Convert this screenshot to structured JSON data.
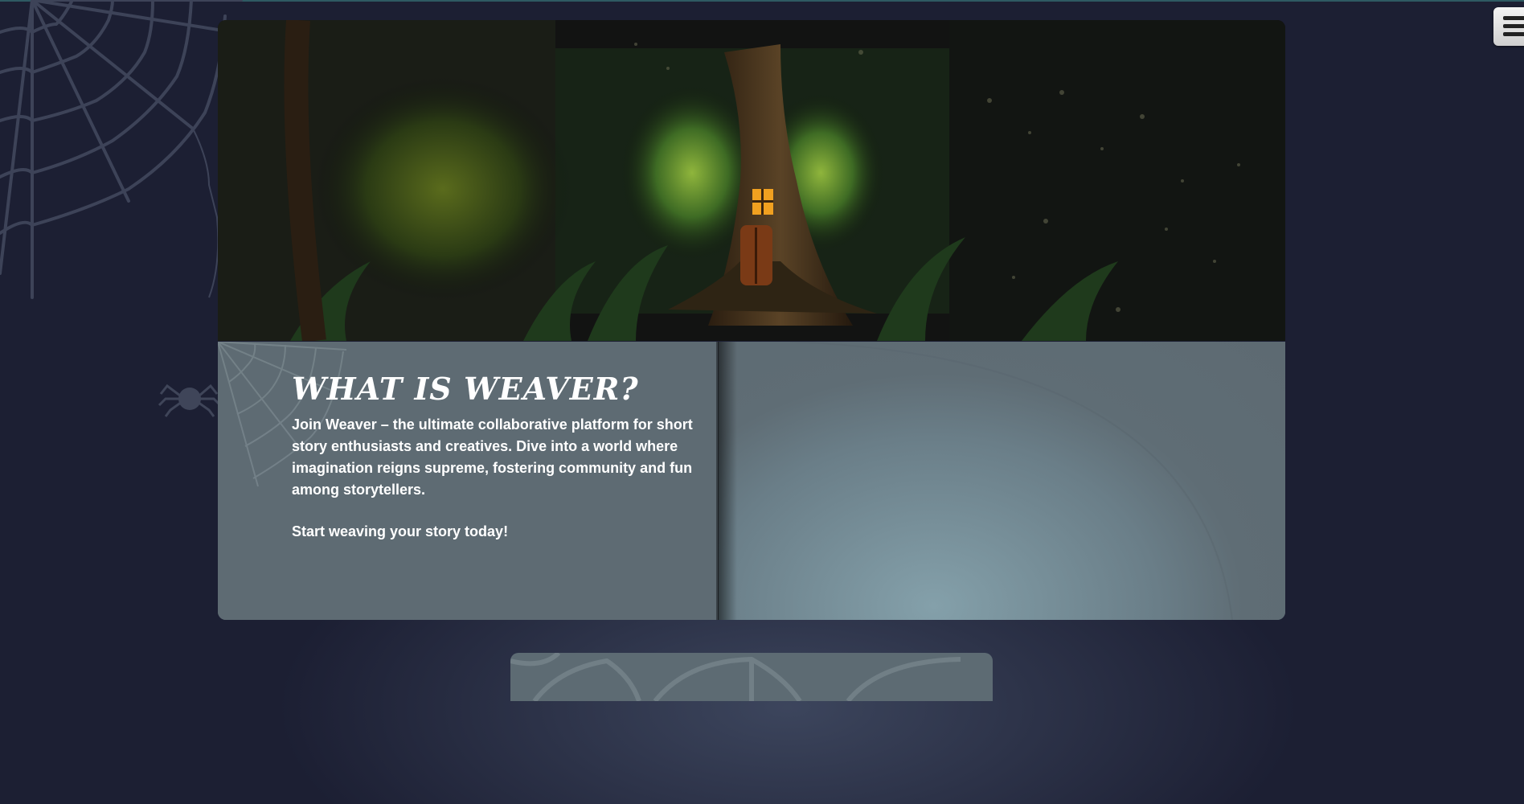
{
  "about": {
    "title": "WHAT IS WEAVER?",
    "body": "Join Weaver – the ultimate collaborative platform for short story enthusiasts and creatives. Dive into a world where imagination reigns supreme, fostering community and fun among storytellers.",
    "cta": "Start weaving your story today!"
  },
  "menu": {
    "icon": "hamburger-menu-icon"
  },
  "colors": {
    "page_background": "#1c1f33",
    "panel": "#5d6b73",
    "text": "#ffffff"
  }
}
